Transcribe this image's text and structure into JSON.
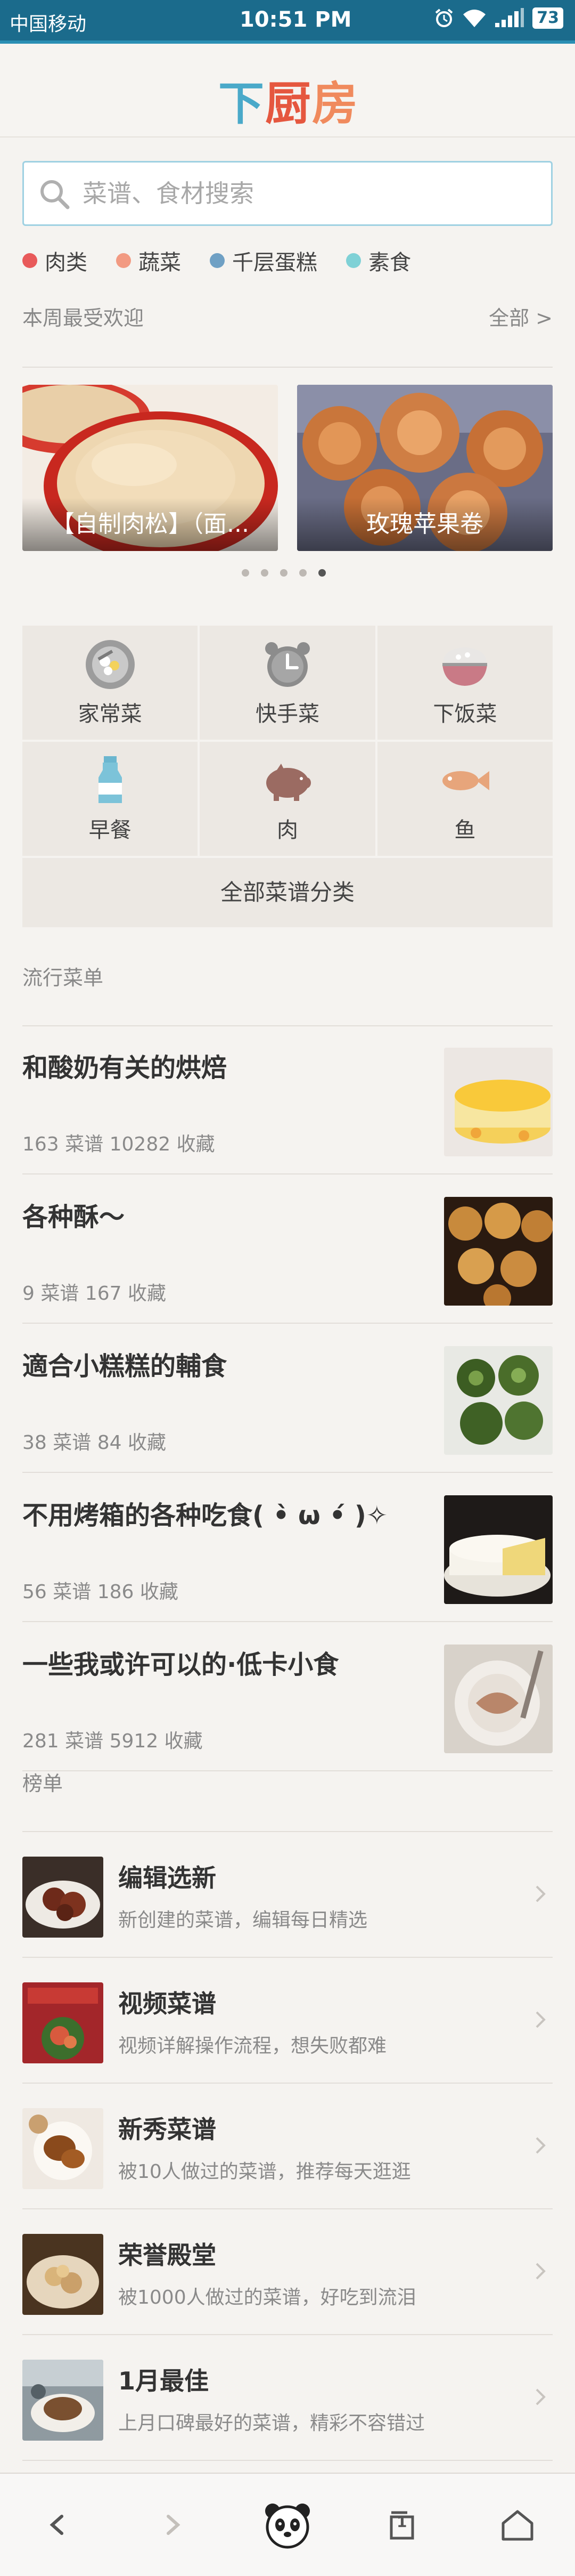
{
  "status_bar": {
    "carrier": "中国移动",
    "time": "10:51 PM",
    "battery": "73"
  },
  "header": {
    "logo_chars": [
      "下",
      "厨",
      "房"
    ],
    "colors": {
      "brand_blue": "#4aa9c9",
      "brand_red": "#e5573f",
      "brand_orange": "#f08a5d"
    }
  },
  "search": {
    "placeholder": "菜谱、食材搜索"
  },
  "tags": [
    {
      "label": "肉类",
      "color": "#e85a5a"
    },
    {
      "label": "蔬菜",
      "color": "#f29a82"
    },
    {
      "label": "千层蛋糕",
      "color": "#6fa0c4"
    },
    {
      "label": "素食",
      "color": "#7fd1d6"
    }
  ],
  "weekly": {
    "title": "本周最受欢迎",
    "all_link": "全部 >",
    "slides": [
      {
        "caption": "【自制肉松】（面..."
      },
      {
        "caption": "玫瑰苹果卷"
      }
    ],
    "dot_count": 5,
    "active_dot": 4
  },
  "categories": {
    "items": [
      {
        "label": "家常菜",
        "icon": "dishes-icon"
      },
      {
        "label": "快手菜",
        "icon": "alarm-clock-icon"
      },
      {
        "label": "下饭菜",
        "icon": "rice-bowl-icon"
      },
      {
        "label": "早餐",
        "icon": "milk-bottle-icon"
      },
      {
        "label": "肉",
        "icon": "pig-icon"
      },
      {
        "label": "鱼",
        "icon": "fish-icon"
      }
    ],
    "all_label": "全部菜谱分类"
  },
  "trending": {
    "title": "流行菜单",
    "items": [
      {
        "title": "和酸奶有关的烘焙",
        "meta": "163 菜谱   10282 收藏"
      },
      {
        "title": "各种酥～",
        "meta": "9 菜谱   167 收藏"
      },
      {
        "title": "適合小糕糕的輔食",
        "meta": "38 菜谱   84 收藏"
      },
      {
        "title": "不用烤箱的各种吃食( •̀ ω •́ )✧",
        "meta": "56 菜谱   186 收藏"
      },
      {
        "title": "一些我或许可以的·低卡小食",
        "meta": "281 菜谱   5912 收藏"
      }
    ]
  },
  "ranking": {
    "title": "榜单",
    "items": [
      {
        "title": "编辑选新",
        "subtitle": "新创建的菜谱，编辑每日精选"
      },
      {
        "title": "视频菜谱",
        "subtitle": "视频详解操作流程，想失败都难"
      },
      {
        "title": "新秀菜谱",
        "subtitle": "被10人做过的菜谱，推荐每天逛逛"
      },
      {
        "title": "荣誉殿堂",
        "subtitle": "被1000人做过的菜谱，好吃到流泪"
      },
      {
        "title": "1月最佳",
        "subtitle": "上月口碑最好的菜谱，精彩不容错过"
      }
    ]
  },
  "navbar": {
    "items": [
      "back-icon",
      "forward-icon",
      "panda-home-icon",
      "tabs-icon",
      "home-icon"
    ],
    "tabs_count": "1"
  }
}
